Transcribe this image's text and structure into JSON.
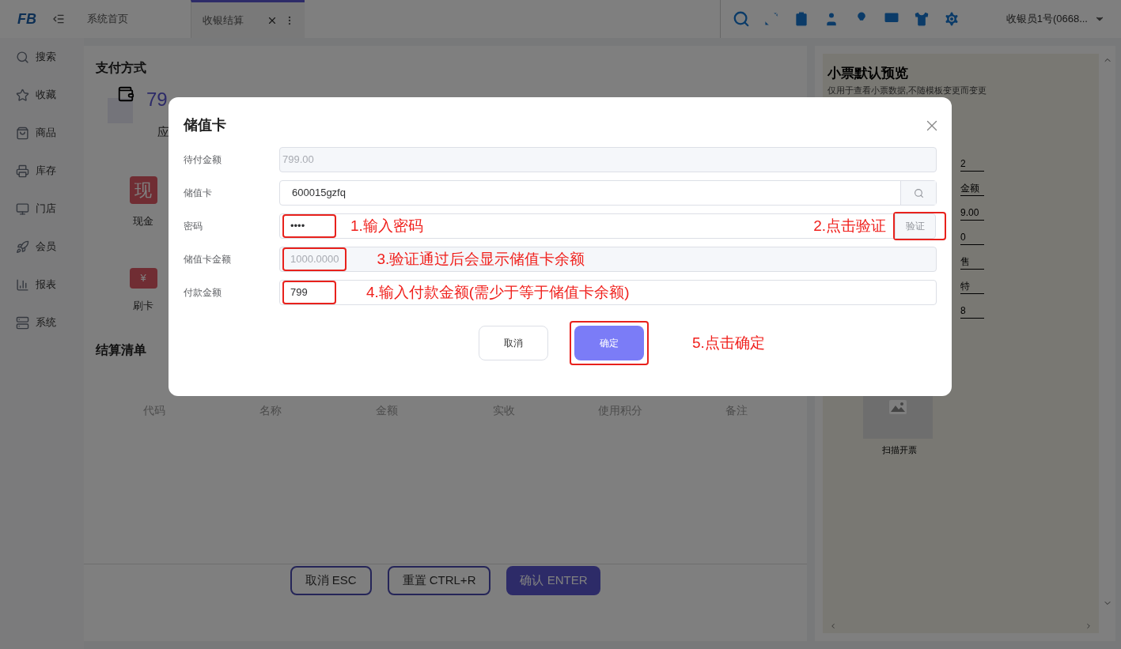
{
  "header": {
    "logo": "FB",
    "tabs": [
      {
        "label": "系统首页",
        "selected": false
      },
      {
        "label": "收银结算",
        "selected": true
      }
    ],
    "user": "收银员1号(0668..."
  },
  "sidebar": {
    "items": [
      {
        "label": "搜索"
      },
      {
        "label": "收藏"
      },
      {
        "label": "商品"
      },
      {
        "label": "库存"
      },
      {
        "label": "门店"
      },
      {
        "label": "会员"
      },
      {
        "label": "报表"
      },
      {
        "label": "系统"
      }
    ]
  },
  "payment": {
    "title": "支付方式",
    "amount": "79",
    "amount_label": "应",
    "methods": [
      {
        "kind": "cash",
        "label": "现金",
        "icon_text": "现"
      },
      {
        "kind": "card",
        "label": "刷卡",
        "icon_text": "¥"
      }
    ]
  },
  "settlement": {
    "title": "结算清单",
    "columns": [
      "代码",
      "名称",
      "金额",
      "实收",
      "使用积分",
      "备注"
    ]
  },
  "actions": [
    {
      "label": "取消 ESC",
      "kind": "outline"
    },
    {
      "label": "重置 CTRL+R",
      "kind": "outline"
    },
    {
      "label": "确认 ENTER",
      "kind": "primary"
    }
  ],
  "receipt": {
    "title": "小票默认预览",
    "subtitle": "仅用于查看小票数据,不随模板变更而变更",
    "fragments": [
      "2",
      "金额",
      "9.00",
      "0",
      "售",
      "特",
      "8"
    ],
    "scan_label": "扫描开票"
  },
  "dialog": {
    "title": "储值卡",
    "fields": [
      {
        "kind": "plain",
        "label": "待付金额",
        "value": "799.00",
        "disabled": true
      },
      {
        "kind": "search",
        "label": "储值卡",
        "value": "600015gzfq",
        "disabled": false
      },
      {
        "kind": "verify",
        "label": "密码",
        "value": "••••",
        "disabled": false,
        "highlighted": true,
        "note": "1.输入密码",
        "button": {
          "label": "验证",
          "highlighted": true,
          "note": "2.点击验证"
        }
      },
      {
        "kind": "plain",
        "label": "储值卡金额",
        "value": "1000.0000",
        "disabled": true,
        "highlighted": true,
        "note": "3.验证通过后会显示储值卡余额"
      },
      {
        "kind": "plain",
        "label": "付款金额",
        "value": "799",
        "disabled": false,
        "highlighted": true,
        "note": "4.输入付款金额(需少于等于储值卡余额)"
      }
    ],
    "cancel": {
      "label": "取消"
    },
    "confirm": {
      "label": "确定",
      "highlighted": true,
      "note": "5.点击确定"
    }
  }
}
